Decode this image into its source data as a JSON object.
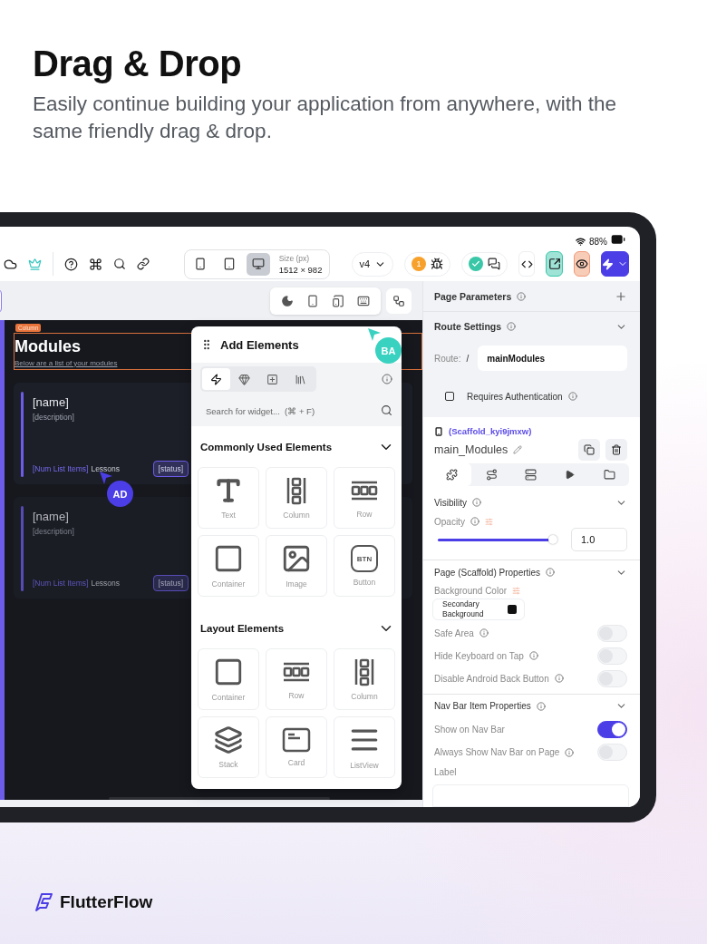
{
  "header": {
    "title": "Drag & Drop",
    "subtitle": "Easily continue building your application from anywhere, with the same friendly drag & drop."
  },
  "status_bar": {
    "battery": "88%"
  },
  "toolbar": {
    "devices": [
      {
        "kind": "phone",
        "selected": false
      },
      {
        "kind": "tablet",
        "selected": false
      },
      {
        "kind": "desktop",
        "selected": true
      }
    ],
    "size_label": "Size (px)",
    "size_value": "1512 × 982",
    "version": "v4",
    "issues": "1"
  },
  "canvas": {
    "column_tag": "Column",
    "title": "Modules",
    "subtitle": "Below are a list of your modules",
    "cards": [
      {
        "name": "[name]",
        "description": "[description]",
        "count": "[Num List Items]",
        "suffix": "Lessons",
        "status": "[status]",
        "dimmed": false
      },
      {
        "name": "[name]",
        "description": "[description]",
        "count": "[Num List Items]",
        "suffix": "Lessons",
        "status": "[status]",
        "dimmed": true
      }
    ],
    "cursors": [
      {
        "initials": "AD",
        "color": "#4b3ee6"
      },
      {
        "initials": "BA",
        "color": "#39d2c0"
      }
    ]
  },
  "add_elements": {
    "title": "Add Elements",
    "tabs": [
      {
        "kind": "flutter",
        "selected": true
      },
      {
        "kind": "gem",
        "selected": false
      },
      {
        "kind": "component",
        "selected": false
      },
      {
        "kind": "library",
        "selected": false
      }
    ],
    "search_placeholder": "Search for widget...  (⌘ + F)",
    "sections": [
      {
        "title": "Commonly Used Elements",
        "items": [
          {
            "kind": "text",
            "label": "Text"
          },
          {
            "kind": "column",
            "label": "Column"
          },
          {
            "kind": "row",
            "label": "Row"
          },
          {
            "kind": "container",
            "label": "Container"
          },
          {
            "kind": "image",
            "label": "Image"
          },
          {
            "kind": "button",
            "label": "Button",
            "icon_text": "BTN"
          }
        ]
      },
      {
        "title": "Layout Elements",
        "items": [
          {
            "kind": "container",
            "label": "Container"
          },
          {
            "kind": "row",
            "label": "Row"
          },
          {
            "kind": "column",
            "label": "Column"
          },
          {
            "kind": "stack",
            "label": "Stack"
          },
          {
            "kind": "card",
            "label": "Card"
          },
          {
            "kind": "list",
            "label": "ListView"
          }
        ]
      }
    ]
  },
  "properties": {
    "page_parameters": "Page Parameters",
    "route_settings": "Route Settings",
    "route_label": "Route:",
    "route_slash": "/",
    "route_value": "mainModules",
    "requires_auth": {
      "label": "Requires Authentication",
      "checked": false
    },
    "widget_id": "(Scaffold_kyi9jmxw)",
    "page_name": "main_Modules",
    "tabs": [
      {
        "kind": "widget",
        "selected": true
      },
      {
        "kind": "actions",
        "selected": false
      },
      {
        "kind": "backend",
        "selected": false
      },
      {
        "kind": "play",
        "selected": false
      },
      {
        "kind": "folder",
        "selected": false
      }
    ],
    "visibility": "Visibility",
    "opacity_label": "Opacity",
    "opacity": {
      "level": 0.97,
      "value": "1.0"
    },
    "scaffold_title": "Page (Scaffold) Properties",
    "bg_label": "Background Color",
    "bg_value": "Secondary Background",
    "scaffold_toggles": [
      {
        "label": "Safe Area",
        "info": true,
        "on": false
      },
      {
        "label": "Hide Keyboard on Tap",
        "info": true,
        "on": false
      },
      {
        "label": "Disable Android Back Button",
        "info": true,
        "on": false
      }
    ],
    "nav_title": "Nav Bar Item Properties",
    "nav_toggles": [
      {
        "label": "Show on Nav Bar",
        "info": false,
        "on": true
      },
      {
        "label": "Always Show Nav Bar on Page",
        "info": true,
        "on": false
      }
    ],
    "label_field": "Label"
  },
  "brand": {
    "name": "FlutterFlow"
  }
}
